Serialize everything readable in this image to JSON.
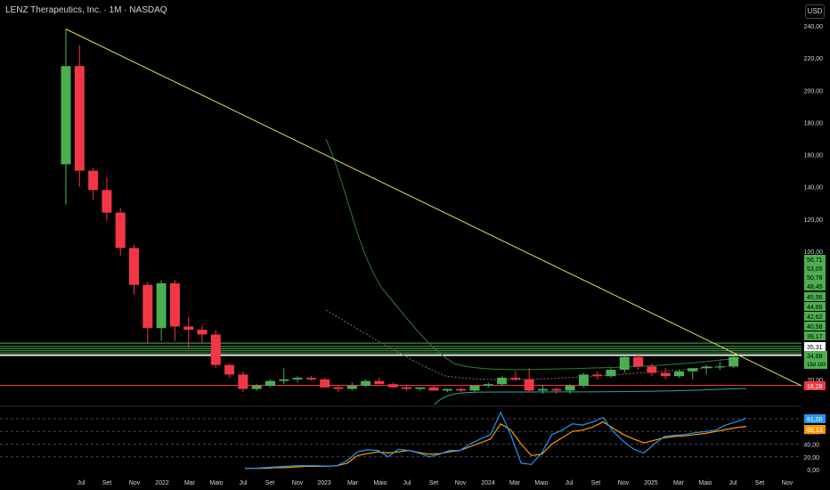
{
  "header": {
    "title": "LENZ Therapeutics, Inc. · 1M · NASDAQ",
    "currency": "USD"
  },
  "colors": {
    "up": "#4caf50",
    "down": "#f23645",
    "trendline": "#d4e157",
    "level": "#4caf50",
    "support": "#f23645",
    "ma_fast": "#2196f3",
    "ma_slow": "#ff9800",
    "axis_text": "#d1d4dc"
  },
  "chart_data": {
    "type": "candlestick",
    "title": "LENZ Therapeutics, Inc. · 1M · NASDAQ",
    "x_tick_labels": [
      "Jul",
      "Set",
      "Nov",
      "2022",
      "Mar",
      "Maio",
      "Jul",
      "Set",
      "Nov",
      "2023",
      "Mar",
      "Maio",
      "Jul",
      "Set",
      "Nov",
      "2024",
      "Mar",
      "Maio",
      "Jul",
      "Set",
      "Nov",
      "2025",
      "Mar",
      "Maio",
      "Jul",
      "Set",
      "Nov"
    ],
    "y_tick_labels": [
      "240,00",
      "220,00",
      "200,00",
      "180,00",
      "160,00",
      "140,00",
      "120,00",
      "100,00",
      "80,00",
      "60,00",
      "40,00",
      "20,00"
    ],
    "price_scale_levels": [
      240,
      220,
      200,
      180,
      160,
      140,
      120,
      100,
      80,
      60,
      40,
      20
    ],
    "candles": [
      {
        "o": 154,
        "h": 238,
        "l": 129,
        "c": 215
      },
      {
        "o": 215,
        "h": 228,
        "l": 140,
        "c": 150
      },
      {
        "o": 150,
        "h": 152,
        "l": 132,
        "c": 138
      },
      {
        "o": 138,
        "h": 146,
        "l": 119,
        "c": 124
      },
      {
        "o": 124,
        "h": 127,
        "l": 97,
        "c": 102
      },
      {
        "o": 102,
        "h": 104,
        "l": 73,
        "c": 79
      },
      {
        "o": 79,
        "h": 81,
        "l": 43,
        "c": 52
      },
      {
        "o": 52,
        "h": 82,
        "l": 44,
        "c": 80
      },
      {
        "o": 80,
        "h": 82,
        "l": 44,
        "c": 53
      },
      {
        "o": 53,
        "h": 59,
        "l": 40,
        "c": 51
      },
      {
        "o": 51,
        "h": 54,
        "l": 43,
        "c": 48
      },
      {
        "o": 48,
        "h": 51,
        "l": 27,
        "c": 29
      },
      {
        "o": 29,
        "h": 30,
        "l": 21,
        "c": 23
      },
      {
        "o": 23,
        "h": 25,
        "l": 12,
        "c": 14
      },
      {
        "o": 14,
        "h": 17,
        "l": 13,
        "c": 16
      },
      {
        "o": 16,
        "h": 20,
        "l": 15,
        "c": 19
      },
      {
        "o": 19,
        "h": 27,
        "l": 17,
        "c": 20
      },
      {
        "o": 20,
        "h": 22,
        "l": 18,
        "c": 21
      },
      {
        "o": 21,
        "h": 22,
        "l": 19,
        "c": 20
      },
      {
        "o": 20,
        "h": 21,
        "l": 16,
        "c": 15
      },
      {
        "o": 15,
        "h": 16,
        "l": 12,
        "c": 14
      },
      {
        "o": 14,
        "h": 18,
        "l": 13,
        "c": 16
      },
      {
        "o": 16,
        "h": 20,
        "l": 15,
        "c": 19
      },
      {
        "o": 19,
        "h": 21,
        "l": 17,
        "c": 17
      },
      {
        "o": 17,
        "h": 18,
        "l": 15,
        "c": 15
      },
      {
        "o": 15,
        "h": 16,
        "l": 13,
        "c": 14
      },
      {
        "o": 14,
        "h": 15,
        "l": 13,
        "c": 15
      },
      {
        "o": 15,
        "h": 16,
        "l": 13,
        "c": 13
      },
      {
        "o": 13,
        "h": 14,
        "l": 12,
        "c": 14
      },
      {
        "o": 14,
        "h": 15,
        "l": 12,
        "c": 13
      },
      {
        "o": 13,
        "h": 16,
        "l": 12,
        "c": 16
      },
      {
        "o": 16,
        "h": 18,
        "l": 15,
        "c": 17
      },
      {
        "o": 17,
        "h": 22,
        "l": 16,
        "c": 21
      },
      {
        "o": 21,
        "h": 25,
        "l": 19,
        "c": 20
      },
      {
        "o": 20,
        "h": 27,
        "l": 12,
        "c": 13
      },
      {
        "o": 13,
        "h": 16,
        "l": 11,
        "c": 14
      },
      {
        "o": 14,
        "h": 15,
        "l": 11,
        "c": 13
      },
      {
        "o": 13,
        "h": 17,
        "l": 11,
        "c": 16
      },
      {
        "o": 16,
        "h": 24,
        "l": 15,
        "c": 23
      },
      {
        "o": 23,
        "h": 25,
        "l": 20,
        "c": 22
      },
      {
        "o": 22,
        "h": 27,
        "l": 21,
        "c": 26
      },
      {
        "o": 26,
        "h": 35,
        "l": 24,
        "c": 34
      },
      {
        "o": 34,
        "h": 36,
        "l": 26,
        "c": 28
      },
      {
        "o": 28,
        "h": 30,
        "l": 22,
        "c": 24
      },
      {
        "o": 24,
        "h": 27,
        "l": 20,
        "c": 22
      },
      {
        "o": 22,
        "h": 26,
        "l": 21,
        "c": 25
      },
      {
        "o": 25,
        "h": 27,
        "l": 20,
        "c": 27
      },
      {
        "o": 27,
        "h": 29,
        "l": 23,
        "c": 28
      },
      {
        "o": 28,
        "h": 31,
        "l": 26,
        "c": 28
      },
      {
        "o": 28,
        "h": 35,
        "l": 27,
        "c": 34
      }
    ],
    "trendline_start": {
      "candle": 0,
      "price": 238
    },
    "trendline_end_label": "34,68",
    "horizontal_levels": [
      42.62,
      40.58,
      39.17,
      37.8,
      36.5,
      35.31
    ],
    "support_level": 16.28,
    "right_labels_green": [
      "56,71",
      "53,05",
      "50,78",
      "48,45",
      "45,56",
      "44,66",
      "42,62",
      "40,58",
      "39,17"
    ],
    "label_white": "35,31",
    "label_last": "34,68",
    "label_countdown": "18d 16h",
    "label_red": "16,28",
    "indicator": {
      "y_tick_labels": [
        "80,00",
        "60,00",
        "40,00",
        "20,00",
        "0,00"
      ],
      "fast_label": "81,00",
      "slow_label": "68,13",
      "fast": [
        2,
        2,
        3,
        4,
        5,
        6,
        6,
        6,
        5,
        6,
        14,
        28,
        31,
        30,
        20,
        32,
        30,
        26,
        20,
        24,
        30,
        30,
        40,
        48,
        55,
        90,
        54,
        10,
        8,
        26,
        55,
        62,
        72,
        70,
        75,
        82,
        60,
        44,
        32,
        26,
        40,
        52,
        54,
        55,
        58,
        60,
        62,
        70,
        75,
        81
      ],
      "slow": [
        2,
        2,
        2,
        3,
        3,
        4,
        5,
        5,
        5,
        6,
        10,
        22,
        25,
        28,
        26,
        28,
        30,
        27,
        24,
        25,
        28,
        30,
        36,
        42,
        48,
        72,
        62,
        40,
        22,
        24,
        40,
        50,
        60,
        62,
        67,
        75,
        65,
        55,
        48,
        42,
        46,
        50,
        52,
        53,
        55,
        57,
        60,
        63,
        66,
        68
      ]
    }
  }
}
